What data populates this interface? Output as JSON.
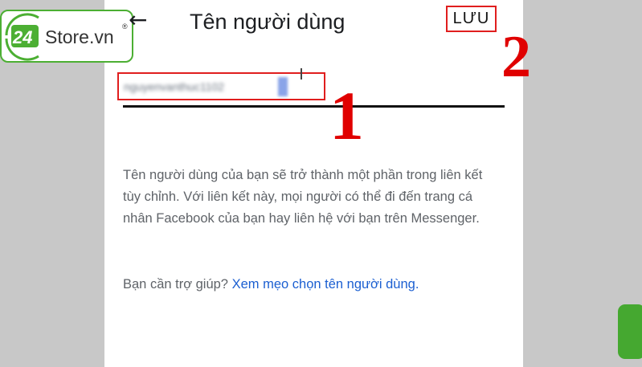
{
  "brand": {
    "logo_number": "24",
    "logo_text": "Store.vn",
    "logo_mark": "®",
    "color": "#4caf33"
  },
  "header": {
    "back_icon": "back-arrow-icon",
    "back_glyph": "←",
    "title": "Tên người dùng",
    "save_label": "LƯU"
  },
  "annotations": {
    "marker_1": "1",
    "marker_2": "2",
    "highlight_color": "#e01e1e"
  },
  "username_field": {
    "value": "nguyenvanthuc1102"
  },
  "info": {
    "text": "Tên người dùng của bạn sẽ trở thành một phần trong liên kết tùy chỉnh. Với liên kết này, mọi người có thể đi đến trang cá nhân Facebook của bạn hay liên hệ với bạn trên Messenger."
  },
  "help": {
    "prefix": "Bạn cần trợ giúp? ",
    "link_text": "Xem mẹo chọn tên người dùng."
  },
  "colors": {
    "link": "#1b5fd1",
    "background": "#c8c8c8"
  }
}
